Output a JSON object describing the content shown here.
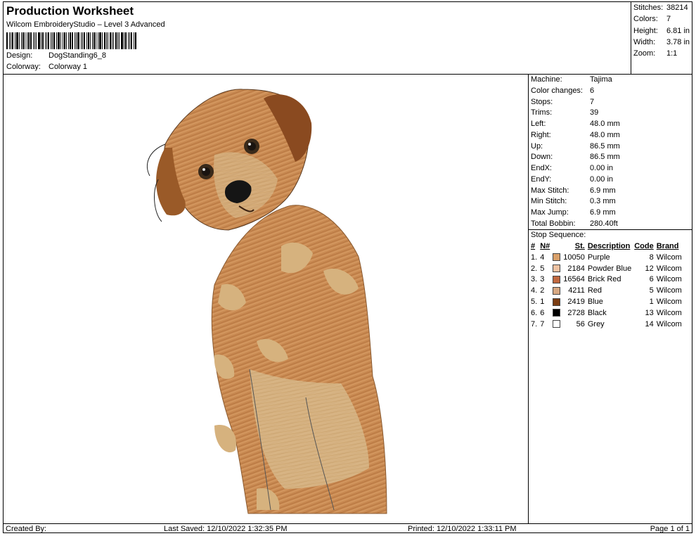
{
  "header": {
    "title": "Production Worksheet",
    "subtitle": "Wilcom EmbroideryStudio – Level 3 Advanced",
    "design_label": "Design:",
    "design_value": "DogStanding6_8",
    "colorway_label": "Colorway:",
    "colorway_value": "Colorway 1"
  },
  "summary": [
    {
      "label": "Stitches:",
      "value": "38214"
    },
    {
      "label": "Colors:",
      "value": "7"
    },
    {
      "label": "Height:",
      "value": "6.81 in"
    },
    {
      "label": "Width:",
      "value": "3.78 in"
    },
    {
      "label": "Zoom:",
      "value": "1:1"
    }
  ],
  "machine_info": [
    {
      "label": "Machine:",
      "value": "Tajima"
    },
    {
      "label": "Color changes:",
      "value": "6"
    },
    {
      "label": "Stops:",
      "value": "7"
    },
    {
      "label": "Trims:",
      "value": "39"
    },
    {
      "label": "Left:",
      "value": "48.0 mm"
    },
    {
      "label": "Right:",
      "value": "48.0 mm"
    },
    {
      "label": "Up:",
      "value": "86.5 mm"
    },
    {
      "label": "Down:",
      "value": "86.5 mm"
    },
    {
      "label": "EndX:",
      "value": "0.00 in"
    },
    {
      "label": "EndY:",
      "value": "0.00 in"
    },
    {
      "label": "Max Stitch:",
      "value": "6.9 mm"
    },
    {
      "label": "Min Stitch:",
      "value": "0.3 mm"
    },
    {
      "label": "Max Jump:",
      "value": "6.9 mm"
    },
    {
      "label": "Total Bobbin:",
      "value": "280.40ft"
    }
  ],
  "stop_sequence": {
    "title": "Stop Sequence:",
    "headers": {
      "num": "#",
      "n": "N#",
      "st": "St.",
      "desc": "Description",
      "code": "Code",
      "brand": "Brand"
    },
    "rows": [
      {
        "num": "1.",
        "n": "4",
        "color": "#d9a06a",
        "st": "10050",
        "desc": "Purple",
        "code": "8",
        "brand": "Wilcom"
      },
      {
        "num": "2.",
        "n": "5",
        "color": "#eec2a2",
        "st": "2184",
        "desc": "Powder Blue",
        "code": "12",
        "brand": "Wilcom"
      },
      {
        "num": "3.",
        "n": "3",
        "color": "#c0683f",
        "st": "16564",
        "desc": "Brick Red",
        "code": "6",
        "brand": "Wilcom"
      },
      {
        "num": "4.",
        "n": "2",
        "color": "#d7a882",
        "st": "4211",
        "desc": "Red",
        "code": "5",
        "brand": "Wilcom"
      },
      {
        "num": "5.",
        "n": "1",
        "color": "#7a3c12",
        "st": "2419",
        "desc": "Blue",
        "code": "1",
        "brand": "Wilcom"
      },
      {
        "num": "6.",
        "n": "6",
        "color": "#000000",
        "st": "2728",
        "desc": "Black",
        "code": "13",
        "brand": "Wilcom"
      },
      {
        "num": "7.",
        "n": "7",
        "color": "#ffffff",
        "st": "56",
        "desc": "Grey",
        "code": "14",
        "brand": "Wilcom"
      }
    ]
  },
  "footer": {
    "created_by": "Created By:",
    "last_saved": "Last Saved: 12/10/2022 1:32:35 PM",
    "printed": "Printed: 12/10/2022 1:33:11 PM",
    "page": "Page 1 of 1"
  }
}
